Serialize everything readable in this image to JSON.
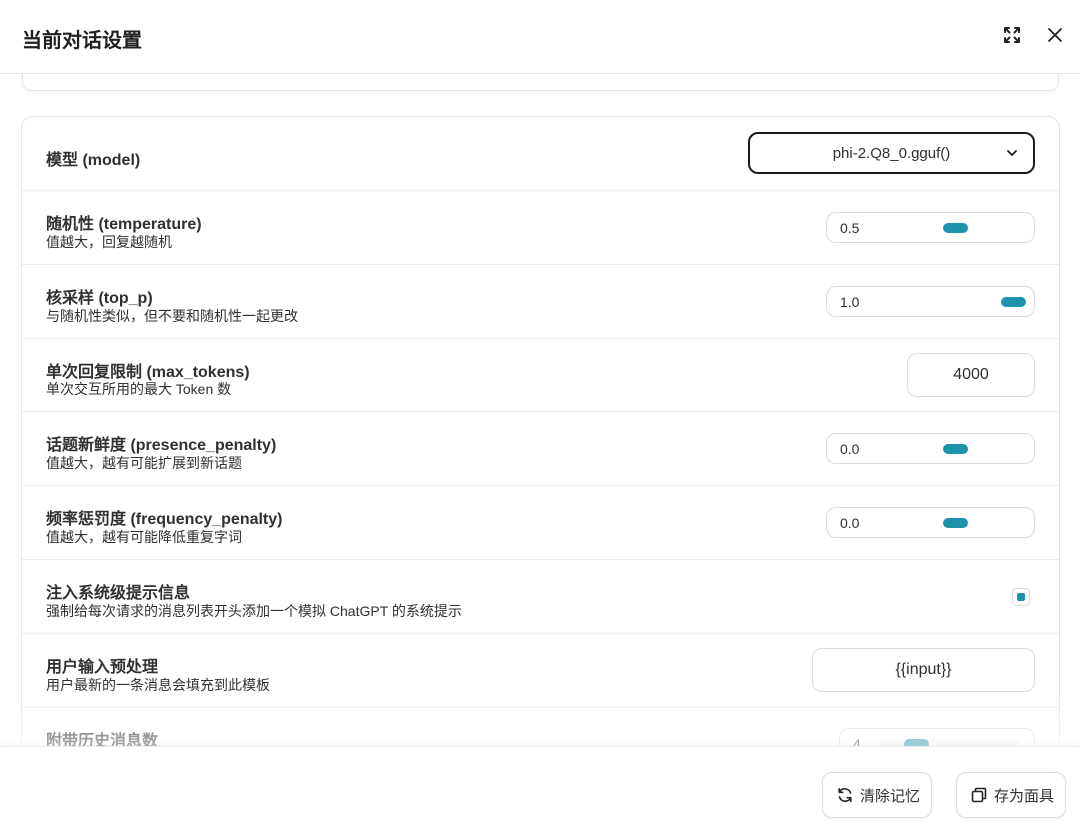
{
  "header": {
    "title": "当前对话设置",
    "fullscreen_icon": "fullscreen-icon",
    "close_icon": "close-icon"
  },
  "settings": {
    "model": {
      "title": "模型 (model)",
      "selected": "phi-2.Q8_0.gguf()"
    },
    "temperature": {
      "title": "随机性 (temperature)",
      "subtitle": "值越大，回复越随机",
      "value": "0.5"
    },
    "top_p": {
      "title": "核采样 (top_p)",
      "subtitle": "与随机性类似，但不要和随机性一起更改",
      "value": "1.0"
    },
    "max_tokens": {
      "title": "单次回复限制 (max_tokens)",
      "subtitle": "单次交互所用的最大 Token 数",
      "value": "4000"
    },
    "presence_penalty": {
      "title": "话题新鲜度 (presence_penalty)",
      "subtitle": "值越大，越有可能扩展到新话题",
      "value": "0.0"
    },
    "frequency_penalty": {
      "title": "频率惩罚度 (frequency_penalty)",
      "subtitle": "值越大，越有可能降低重复字词",
      "value": "0.0"
    },
    "inject_system": {
      "title": "注入系统级提示信息",
      "subtitle": "强制给每次请求的消息列表开头添加一个模拟 ChatGPT 的系统提示",
      "checked": true
    },
    "input_template": {
      "title": "用户输入预处理",
      "subtitle": "用户最新的一条消息会填充到此模板",
      "value": "{{input}}"
    },
    "history_count": {
      "title": "附带历史消息数",
      "value": "4"
    }
  },
  "footer": {
    "clear_label": "清除记忆",
    "save_label": "存为面具"
  },
  "colors": {
    "accent": "#1d93ab",
    "border": "#dcdcdc",
    "text": "#303030"
  }
}
